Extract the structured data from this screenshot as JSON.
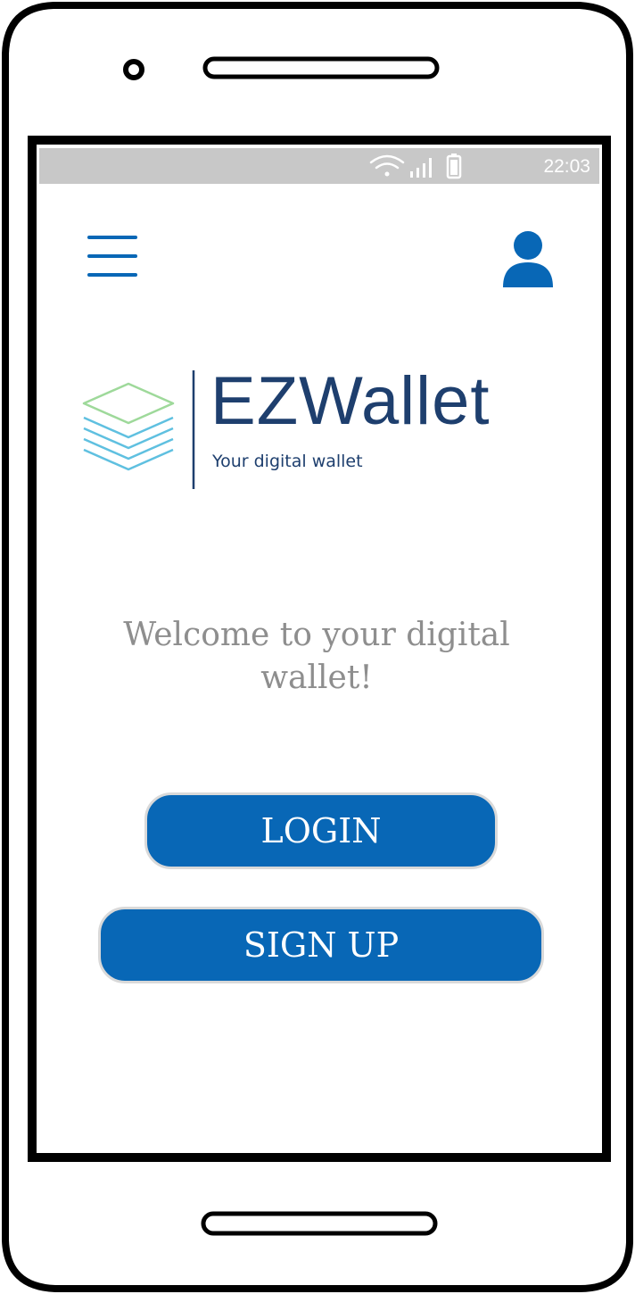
{
  "status_bar": {
    "time": "22:03",
    "icons": [
      "wifi-icon",
      "signal-icon",
      "battery-icon"
    ]
  },
  "header": {
    "menu_icon": "hamburger-menu-icon",
    "profile_icon": "user-profile-icon"
  },
  "logo": {
    "brand_name": "EZWallet",
    "tagline": "Your digital wallet",
    "icon": "stacked-layers-icon"
  },
  "main": {
    "welcome_text": "Welcome to your digital wallet!",
    "login_label": "LOGIN",
    "signup_label": "SIGN UP"
  },
  "colors": {
    "primary": "#0867b6",
    "status_bar": "#c8c8c8",
    "brand_text": "#1e3f6e",
    "welcome_text": "#8e8e8e"
  }
}
